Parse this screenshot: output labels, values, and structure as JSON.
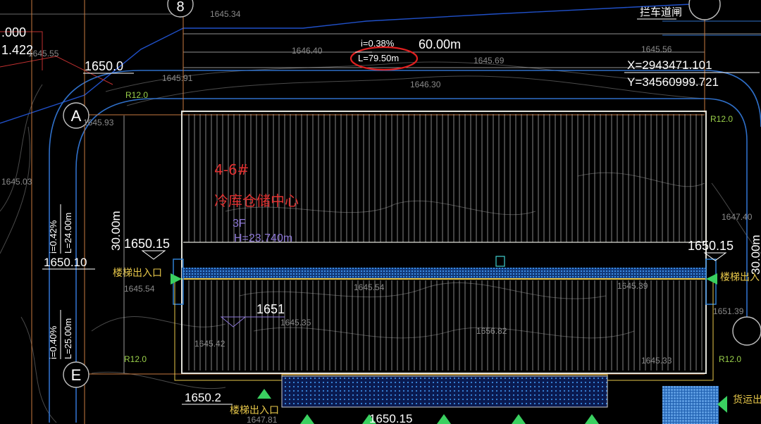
{
  "colors": {
    "background": "#000000",
    "building_outline": "#e0e0d8",
    "hatch": "#a8a8a8",
    "corridor_blue": "#2f7fd0",
    "road_edge": "#2f6fc8",
    "contour": "#5a5a5a",
    "annotation_red": "#e02020",
    "label_yellow": "#e8c84a",
    "marker_green": "#3ad060",
    "building_purple": "#8e78d8",
    "radius_green": "#9ad04a",
    "axis_line": "#c87a40"
  },
  "grid_axes": {
    "a": "A",
    "e": "E",
    "top_left": "8",
    "top_right_partial": "",
    "right_partial": ""
  },
  "slope_top": {
    "grade": "i=0.38%",
    "length": "L=79.50m",
    "dimension": "60.00m"
  },
  "slope_left_upper": {
    "grade": "i=0.42%",
    "length": "L=24.00m"
  },
  "slope_left_lower": {
    "grade": "i=0.40%",
    "length": "L=25.00m"
  },
  "dim_left_partial": ".000",
  "dim_left_partial_2": "1.422",
  "dim_building_depth": "30.00m",
  "dim_right_partial": "30.00m",
  "elevations": {
    "e1650_0": "1650.0",
    "e1650_15_left": "1650.15",
    "e1650_10": "1650.10",
    "e1650_15_right": "1650.15",
    "e1651": "1651",
    "e1650_2": "1650.2",
    "e1650_15_bottom": "1650.15"
  },
  "coordinates": {
    "x": "X=2943471.101",
    "y": "Y=34560999.721"
  },
  "gate_label": "拦车道闸",
  "radii": {
    "tl": "R12.0",
    "tr": "R12.0",
    "bl": "R12.0",
    "br": "R12.0"
  },
  "building": {
    "id": "4-6#",
    "name": "冷库仓储中心",
    "floors": "3F",
    "height": "H=23.740m"
  },
  "entrances": {
    "left": "楼梯出入口",
    "right": "楼梯出入",
    "bottom": "楼梯出入口",
    "cargo": "货运出"
  },
  "contour_labels": [
    "1645.34",
    "1646.40",
    "1645.69",
    "1645.91",
    "1646.30",
    "1645.56",
    "1645.93",
    "1645.55",
    "1645.03",
    "1647.40",
    "1645.54",
    "1645.54",
    "1645.39",
    "1651.39",
    "1645.42",
    "1656.82",
    "1645.35",
    "1645.33",
    "1647.81"
  ]
}
